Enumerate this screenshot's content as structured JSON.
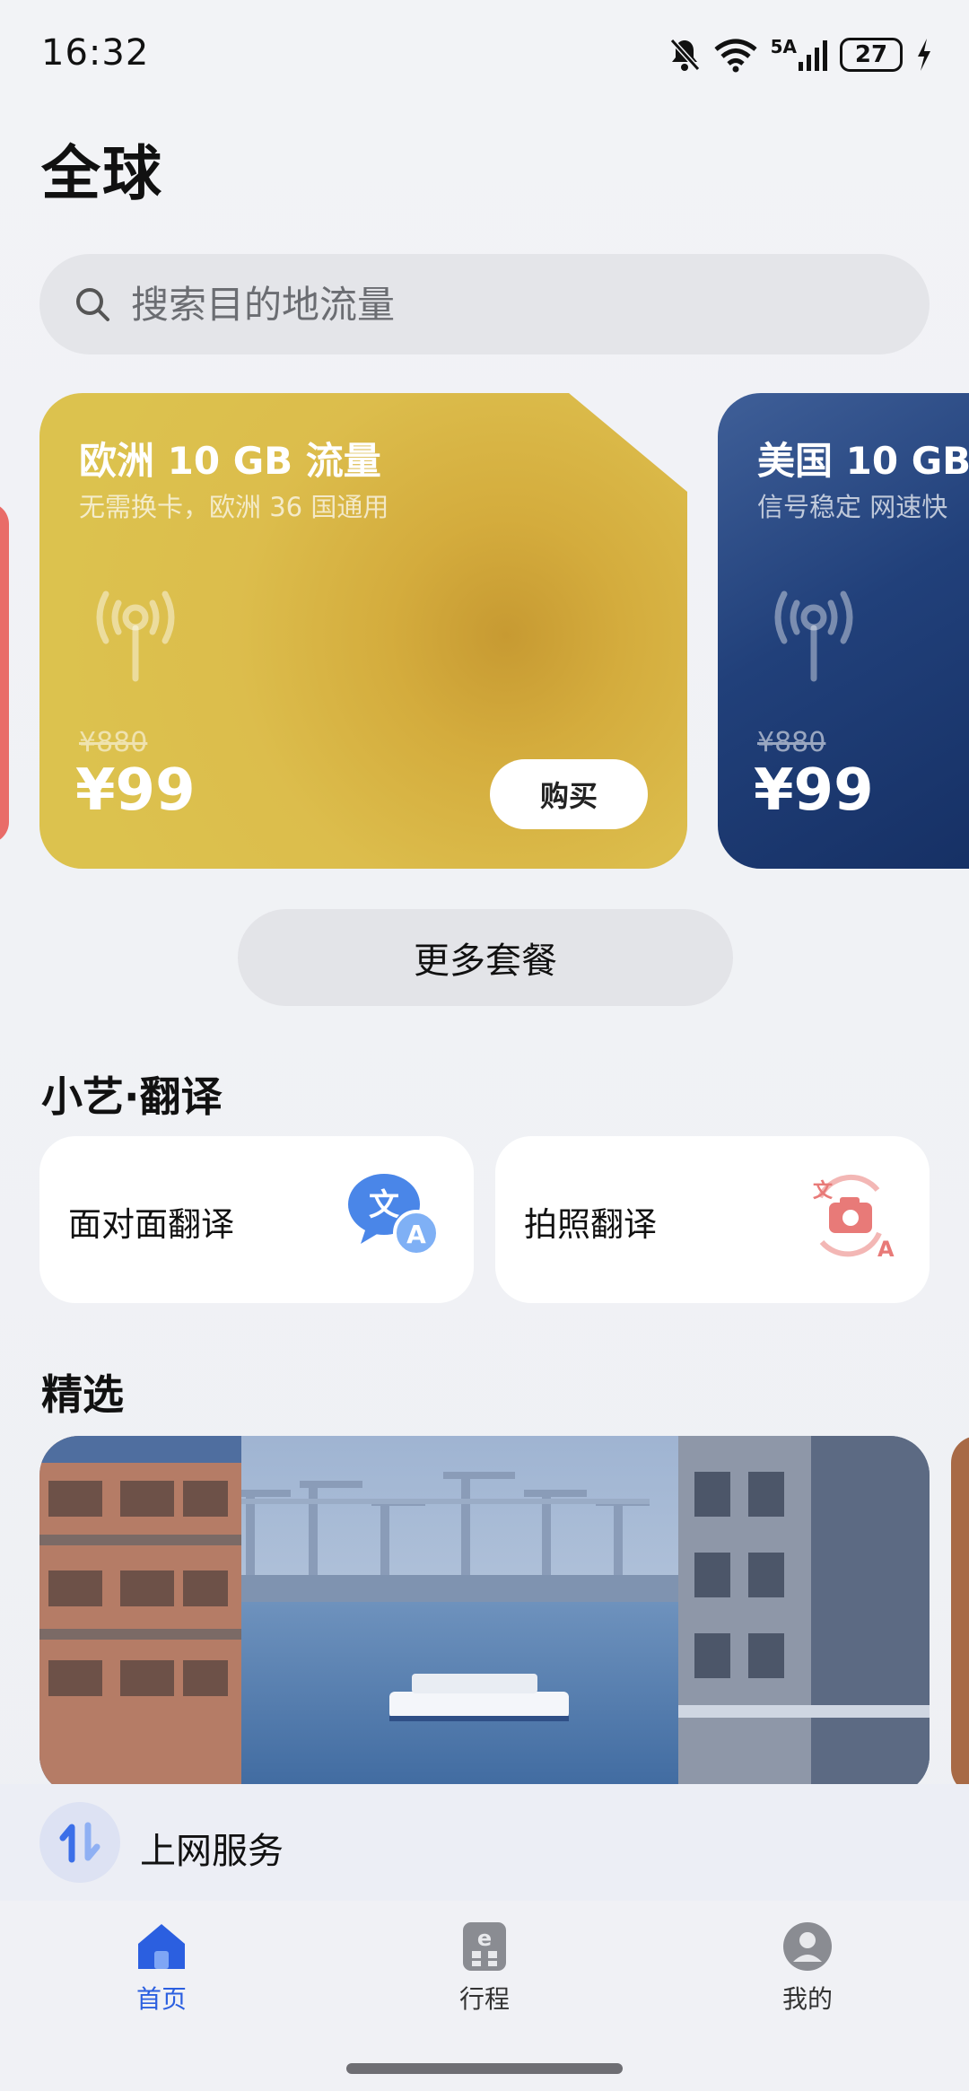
{
  "status": {
    "time": "16:32",
    "battery": "27",
    "network": "5A"
  },
  "page_title": "全球",
  "search": {
    "placeholder": "搜索目的地流量"
  },
  "cards": [
    {
      "title": "欧洲 10 GB 流量",
      "subtitle": "无需换卡，欧洲 36 国通用",
      "old_price": "¥880",
      "price": "¥99",
      "buy_label": "购买",
      "color": "#d9b847"
    },
    {
      "title": "美国 10 GB",
      "subtitle": "信号稳定 网速快",
      "old_price": "¥880",
      "price": "¥99",
      "color": "#1d3b74"
    }
  ],
  "more_label": "更多套餐",
  "translate_section": {
    "title": "小艺·翻译",
    "items": [
      {
        "label": "面对面翻译",
        "icon": "face-to-face-translate-icon"
      },
      {
        "label": "拍照翻译",
        "icon": "photo-translate-icon"
      }
    ]
  },
  "featured": {
    "title": "精选"
  },
  "service": {
    "label": "上网服务"
  },
  "tabs": [
    {
      "label": "首页",
      "icon": "home-icon",
      "active": true
    },
    {
      "label": "行程",
      "icon": "itinerary-icon",
      "active": false
    },
    {
      "label": "我的",
      "icon": "profile-icon",
      "active": false
    }
  ],
  "colors": {
    "accent": "#2b5fe0",
    "translate_blue": "#4a86e8",
    "translate_red": "#e87a78"
  }
}
